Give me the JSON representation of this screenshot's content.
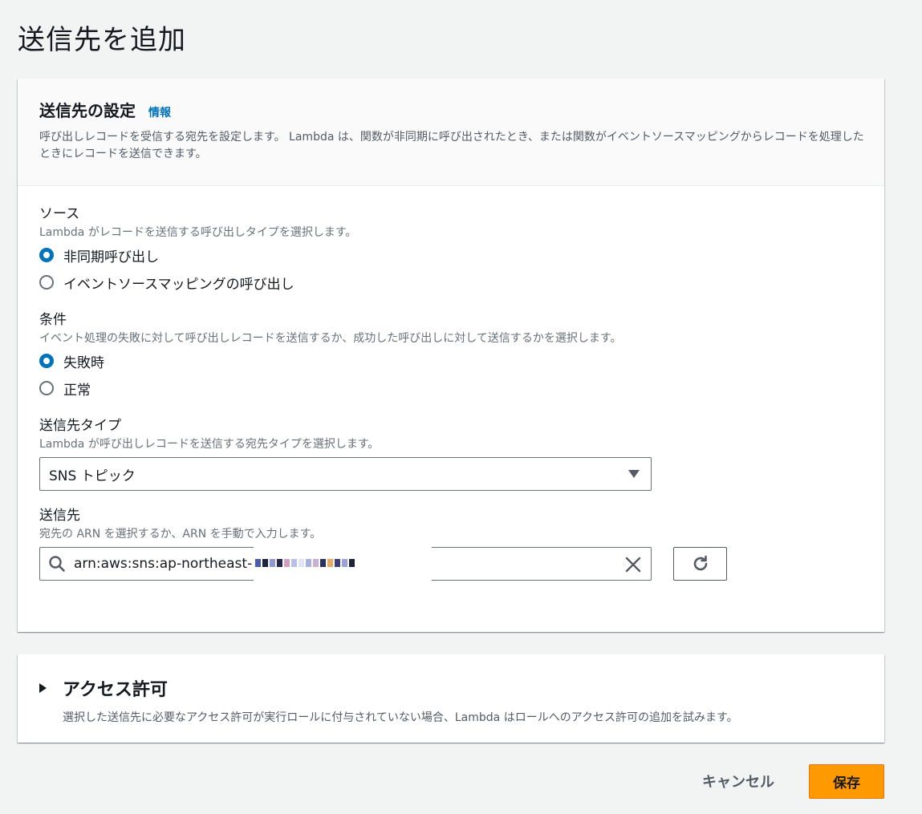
{
  "page": {
    "title": "送信先を追加"
  },
  "destination_panel": {
    "title": "送信先の設定",
    "info_link": "情報",
    "description": "呼び出しレコードを受信する宛先を設定します。 Lambda は、関数が非同期に呼び出されたとき、または関数がイベントソースマッピングからレコードを処理したときにレコードを送信できます。",
    "source": {
      "label": "ソース",
      "description": "Lambda がレコードを送信する呼び出しタイプを選択します。",
      "options": [
        "非同期呼び出し",
        "イベントソースマッピングの呼び出し"
      ],
      "selected": "非同期呼び出し"
    },
    "condition": {
      "label": "条件",
      "description": "イベント処理の失敗に対して呼び出しレコードを送信するか、成功した呼び出しに対して送信するかを選択します。",
      "options": [
        "失敗時",
        "正常"
      ],
      "selected": "失敗時"
    },
    "destination_type": {
      "label": "送信先タイプ",
      "description": "Lambda が呼び出しレコードを送信する宛先タイプを選択します。",
      "value": "SNS トピック"
    },
    "destination": {
      "label": "送信先",
      "description": "宛先の ARN を選択するか、ARN を手動で入力します。",
      "value": "arn:aws:sns:ap-northeast-"
    }
  },
  "access_panel": {
    "title": "アクセス許可",
    "description": "選択した送信先に必要なアクセス許可が実行ロールに付与されていない場合、Lambda はロールへのアクセス許可の追加を試みます。"
  },
  "footer": {
    "cancel_label": "キャンセル",
    "save_label": "保存"
  },
  "colors": {
    "accent": "#0073bb",
    "primary_button": "#ff9900",
    "background": "#f2f3f3"
  }
}
